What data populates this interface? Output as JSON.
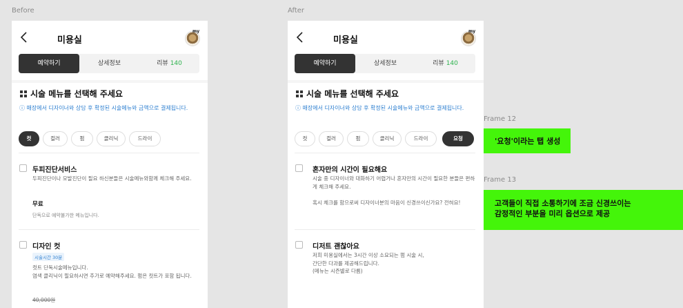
{
  "labels": {
    "before": "Before",
    "after": "After",
    "frame12": "Frame 12",
    "frame13": "Frame 13"
  },
  "app": {
    "title": "미용실",
    "avatar_text": "my",
    "tabs": [
      {
        "label": "예약하기"
      },
      {
        "label": "상세정보"
      },
      {
        "label": "리뷰",
        "count": "140"
      }
    ],
    "section_title": "시술 메뉴를 선택해 주세요",
    "notice": "ⓘ 매장에서 디자이너와 상담 후 확정된 시술메뉴와 금액으로 결제됩니다."
  },
  "before": {
    "chips": [
      "컷",
      "컬러",
      "펌",
      "클리닉",
      "드라이"
    ],
    "items": [
      {
        "title": "두피진단서비스",
        "desc": "두피진단이나 모발진단이 필요 하신분들은 시술메뉴와함께 체크해 주세요.",
        "price": "무료",
        "note": "단독으로 예약불가한 메뉴입니다."
      },
      {
        "title": "디자인 컷",
        "badge": "시술시간 30분",
        "desc": "컷트 단독시술메뉴입니다.\n염색 클리닉이 필요하시면 추가로 예약해주세요. 펌은 컷트가 포함 됩니다.",
        "old_price": "40,000원"
      }
    ]
  },
  "after": {
    "chips": [
      "컷",
      "컬러",
      "펌",
      "클리닉",
      "드라이",
      "요청"
    ],
    "items": [
      {
        "title": "혼자만의 시간이 필요해요",
        "desc": "시술 중 디자이너와 대화하기 어렵거나 혼자만의 시간이 필요한 분들은 편하게 체크해 주세요.\n\n혹시 체크를 함으로써 디자이너분의 마음이 신경쓰이신가요? 전혀요!"
      },
      {
        "title": "디저트 괜찮아요",
        "desc": "저희 미용실에서는 3시간 이상 소요되는 펌 시술 시,\n간단한 다과를 제공해드립니다.\n(메뉴는 시즌별로 다름)"
      }
    ]
  },
  "annotations": {
    "frame12": "'요청'이라는 탭 생성",
    "frame13": "고객들이 직접 소통하기에 조금 신경쓰이는\n감정적인 부분을 미리 옵션으로 제공"
  },
  "colors": {
    "accent_green": "#2fb34f",
    "notice_blue": "#2d7fd0",
    "highlight": "#44f50a",
    "dark": "#333333"
  }
}
